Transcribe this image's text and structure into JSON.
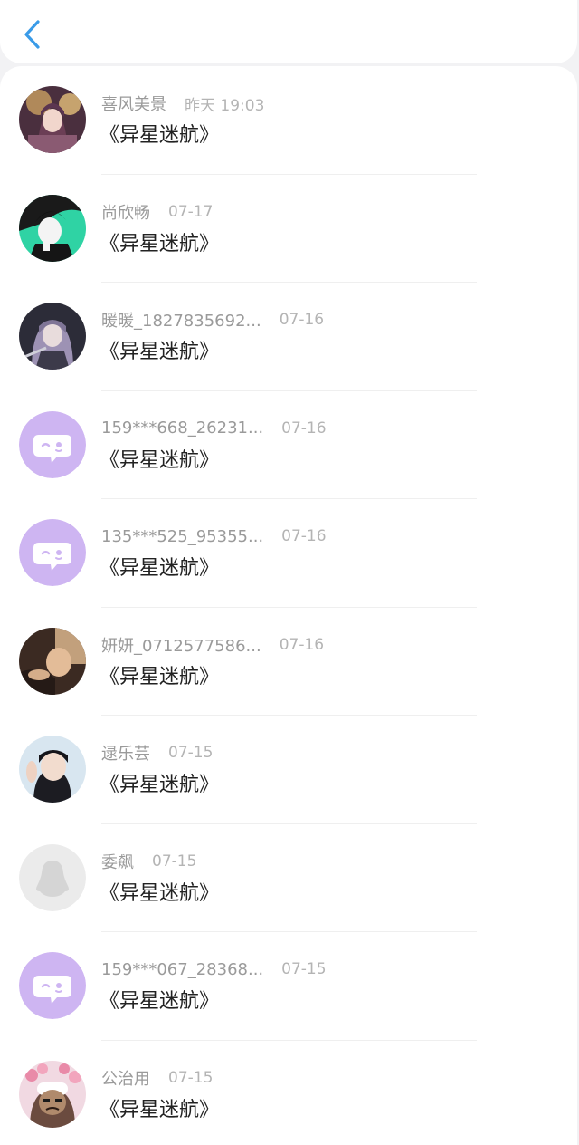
{
  "header": {
    "back_icon": "chevron-left-icon",
    "accent": "#3a9be8"
  },
  "items": [
    {
      "name": "喜风美景",
      "time": "昨天 19:03",
      "message": "《异星迷航》",
      "avatar": "photo-avatar"
    },
    {
      "name": "尚欣畅",
      "time": "07-17",
      "message": "《异星迷航》",
      "avatar": "photo-avatar"
    },
    {
      "name": "暖暖_1827835692...",
      "time": "07-16",
      "message": "《异星迷航》",
      "avatar": "photo-avatar"
    },
    {
      "name": "159***668_26231...",
      "time": "07-16",
      "message": "《异星迷航》",
      "avatar": "default-chat-bubble-avatar"
    },
    {
      "name": "135***525_95355...",
      "time": "07-16",
      "message": "《异星迷航》",
      "avatar": "default-chat-bubble-avatar"
    },
    {
      "name": "妍妍_0712577586...",
      "time": "07-16",
      "message": "《异星迷航》",
      "avatar": "photo-avatar"
    },
    {
      "name": "逯乐芸",
      "time": "07-15",
      "message": "《异星迷航》",
      "avatar": "photo-avatar"
    },
    {
      "name": "委飙",
      "time": "07-15",
      "message": "《异星迷航》",
      "avatar": "default-penguin-avatar"
    },
    {
      "name": "159***067_28368...",
      "time": "07-15",
      "message": "《异星迷航》",
      "avatar": "default-chat-bubble-avatar"
    },
    {
      "name": "公治用",
      "time": "07-15",
      "message": "《异星迷航》",
      "avatar": "photo-avatar"
    }
  ]
}
